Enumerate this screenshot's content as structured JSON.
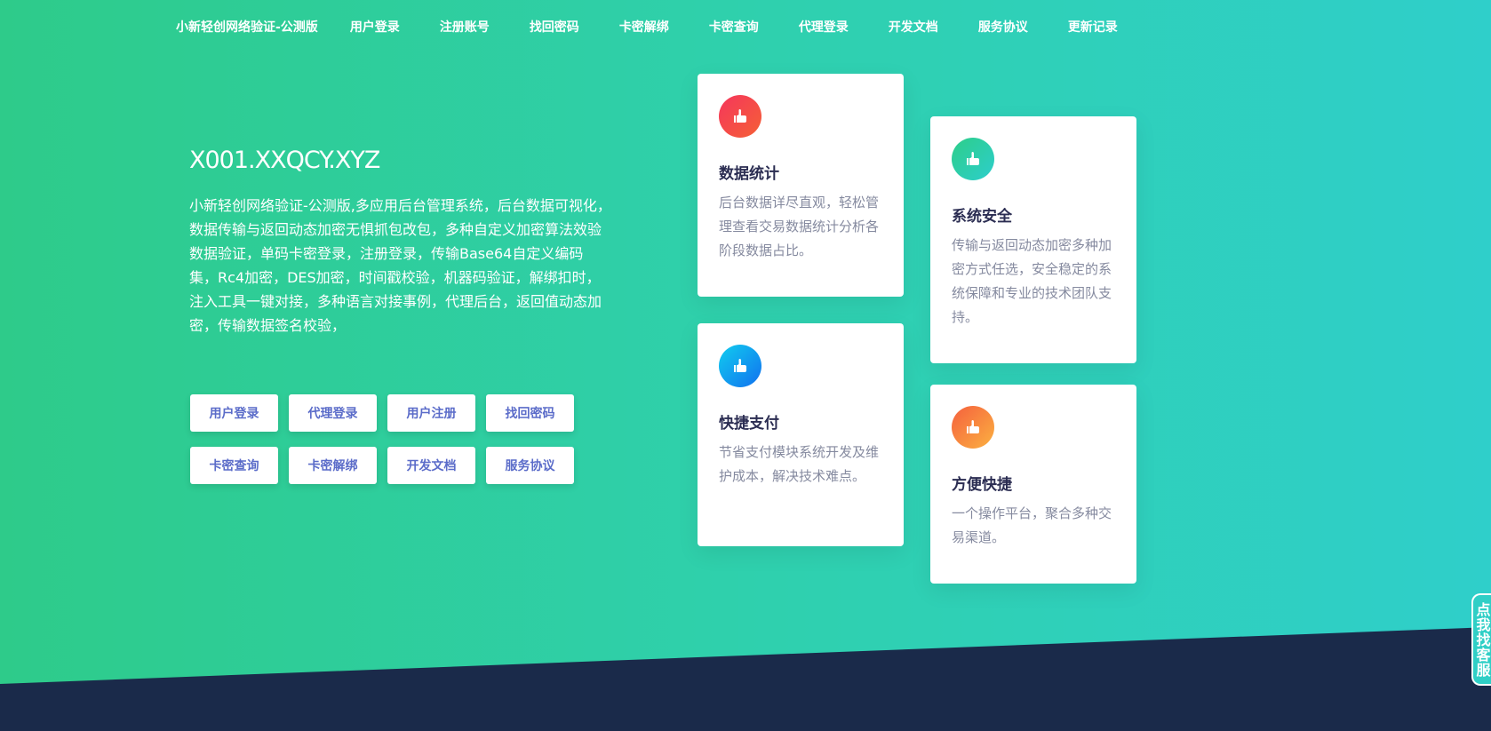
{
  "nav": {
    "brand": "小新轻创网络验证-公测版",
    "links": [
      "用户登录",
      "注册账号",
      "找回密码",
      "卡密解绑",
      "卡密查询",
      "代理登录",
      "开发文档",
      "服务协议",
      "更新记录"
    ]
  },
  "hero": {
    "title": "X001.XXQCY.XYZ",
    "description": "小新轻创网络验证-公测版,多应用后台管理系统，后台数据可视化，数据传输与返回动态加密无惧抓包改包，多种自定义加密算法效验数据验证，单码卡密登录，注册登录，传输Base64自定义编码集，Rc4加密，DES加密，时间戳校验，机器码验证，解绑扣时，注入工具一键对接，多种语言对接事例，代理后台，返回值动态加密，传输数据签名校验，",
    "buttons": [
      "用户登录",
      "代理登录",
      "用户注册",
      "找回密码",
      "卡密查询",
      "卡密解绑",
      "开发文档",
      "服务协议"
    ]
  },
  "features": [
    {
      "title": "数据统计",
      "text": "后台数据详尽直观，轻松管理查看交易数据统计分析各阶段数据占比。",
      "icon": "thumbs-up-icon",
      "color_from": "#f5365c",
      "color_to": "#f56036"
    },
    {
      "title": "系统安全",
      "text": "传输与返回动态加密多种加密方式任选，安全稳定的系统保障和专业的技术团队支持。",
      "icon": "thumbs-up-icon",
      "color_from": "#2dce89",
      "color_to": "#2dcecc"
    },
    {
      "title": "快捷支付",
      "text": "节省支付模块系统开发及维护成本，解决技术难点。",
      "icon": "thumbs-up-icon",
      "color_from": "#11cdef",
      "color_to": "#1171ef"
    },
    {
      "title": "方便快捷",
      "text": "一个操作平台，聚合多种交易渠道。",
      "icon": "thumbs-up-icon",
      "color_from": "#f5603e",
      "color_to": "#fbb140"
    }
  ],
  "customer_service": {
    "label": "点我找客服"
  },
  "colors": {
    "background_from": "#2ecb8a",
    "background_to": "#2fcfca",
    "footer": "#1a2a4a",
    "button_text": "#5b6cc9"
  }
}
